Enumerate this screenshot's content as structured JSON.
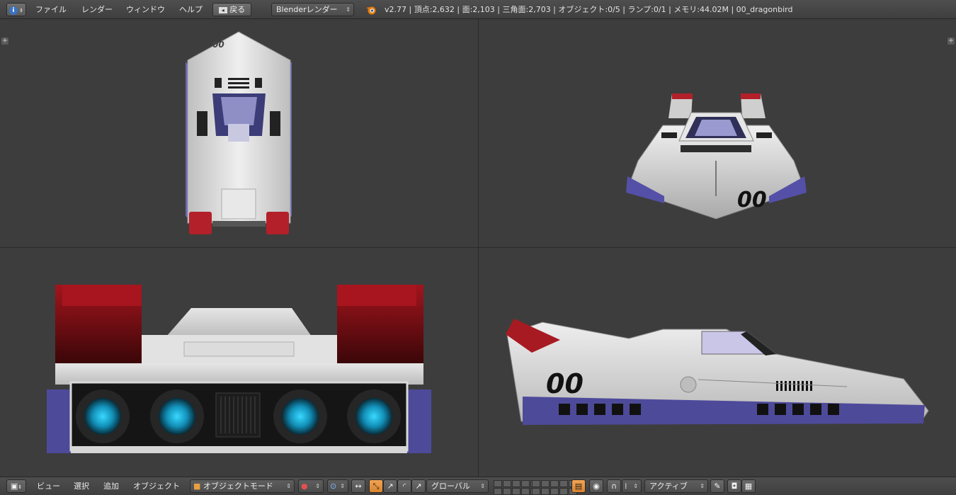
{
  "top_menu": {
    "info_icon": "info-icon",
    "items": [
      "ファイル",
      "レンダー",
      "ウィンドウ",
      "ヘルプ"
    ],
    "back_label": "戻る",
    "render_engine": "Blenderレンダー",
    "stats": "v2.77 | 頂点:2,632 | 面:2,103 | 三角面:2,703 | オブジェクト:0/5 | ランプ:0/1 | メモリ:44.02M | 00_dragonbird"
  },
  "viewports": {
    "plus_glyph": "+",
    "model_number": "00"
  },
  "bottom_bar": {
    "menus": [
      "ビュー",
      "選択",
      "追加",
      "オブジェクト"
    ],
    "mode": "オブジェクトモード",
    "orientation": "グローバル",
    "pivot": "アクティブ"
  },
  "colors": {
    "background": "#3d3d3d",
    "header": "#474747",
    "accent_orange": "#e8923d",
    "engine_glow": "#22c8f0",
    "hull_white": "#d8d8d8",
    "hull_blue": "#4e4a9a",
    "fin_red": "#a11a20"
  }
}
